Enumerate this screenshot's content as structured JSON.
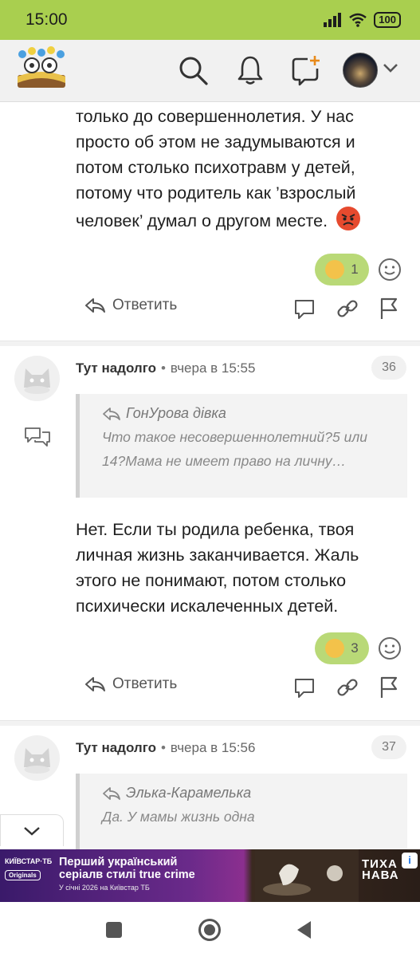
{
  "status_bar": {
    "time": "15:00",
    "battery": "100"
  },
  "app_header": {
    "logo": "site-logo",
    "icons": [
      "search-icon",
      "bell-icon",
      "new-post-icon",
      "avatar",
      "chevron-down-icon"
    ]
  },
  "colors": {
    "accent": "#a9cf4f",
    "reaction_pill": "#b9d977",
    "emoji": "#f3c24a"
  },
  "comments": [
    {
      "text": "только до совершеннолетия. У нас просто об этом не задумываются и потом столько психотравм у детей, потому что родитель как ’взрослый человек’ думал о другом месте.",
      "reaction_count": "1",
      "reply_label": "Ответить"
    },
    {
      "author": "Тут надолго",
      "separator": "•",
      "time": "вчера в 15:55",
      "number": "36",
      "quote_author": "ГонУрова дівка",
      "quote_text": "Что такое несовершеннолетний?5 или 14?Мама не имеет право на личну…",
      "text": "Нет. Если ты родила ребенка, твоя личная жизнь заканчивается. Жаль этого не понимают, потом столько психически искалеченных детей.",
      "reaction_count": "3",
      "reply_label": "Ответить"
    },
    {
      "author": "Тут надолго",
      "separator": "•",
      "time": "вчера в 15:56",
      "number": "37",
      "quote_author": "Элька-Карамелька",
      "quote_text": "Да. У мамы жизнь одна"
    }
  ],
  "ad": {
    "brand_logo": "КИЇВСТАР·ТБ",
    "brand_sub": "Originals",
    "line1": "Перший український",
    "line2": "серіалв стилі true crime",
    "line3": "У січні 2026 на Київстар ТБ",
    "title_mark_1": "ТИХА",
    "title_mark_2": "НАВА",
    "info": "i"
  }
}
